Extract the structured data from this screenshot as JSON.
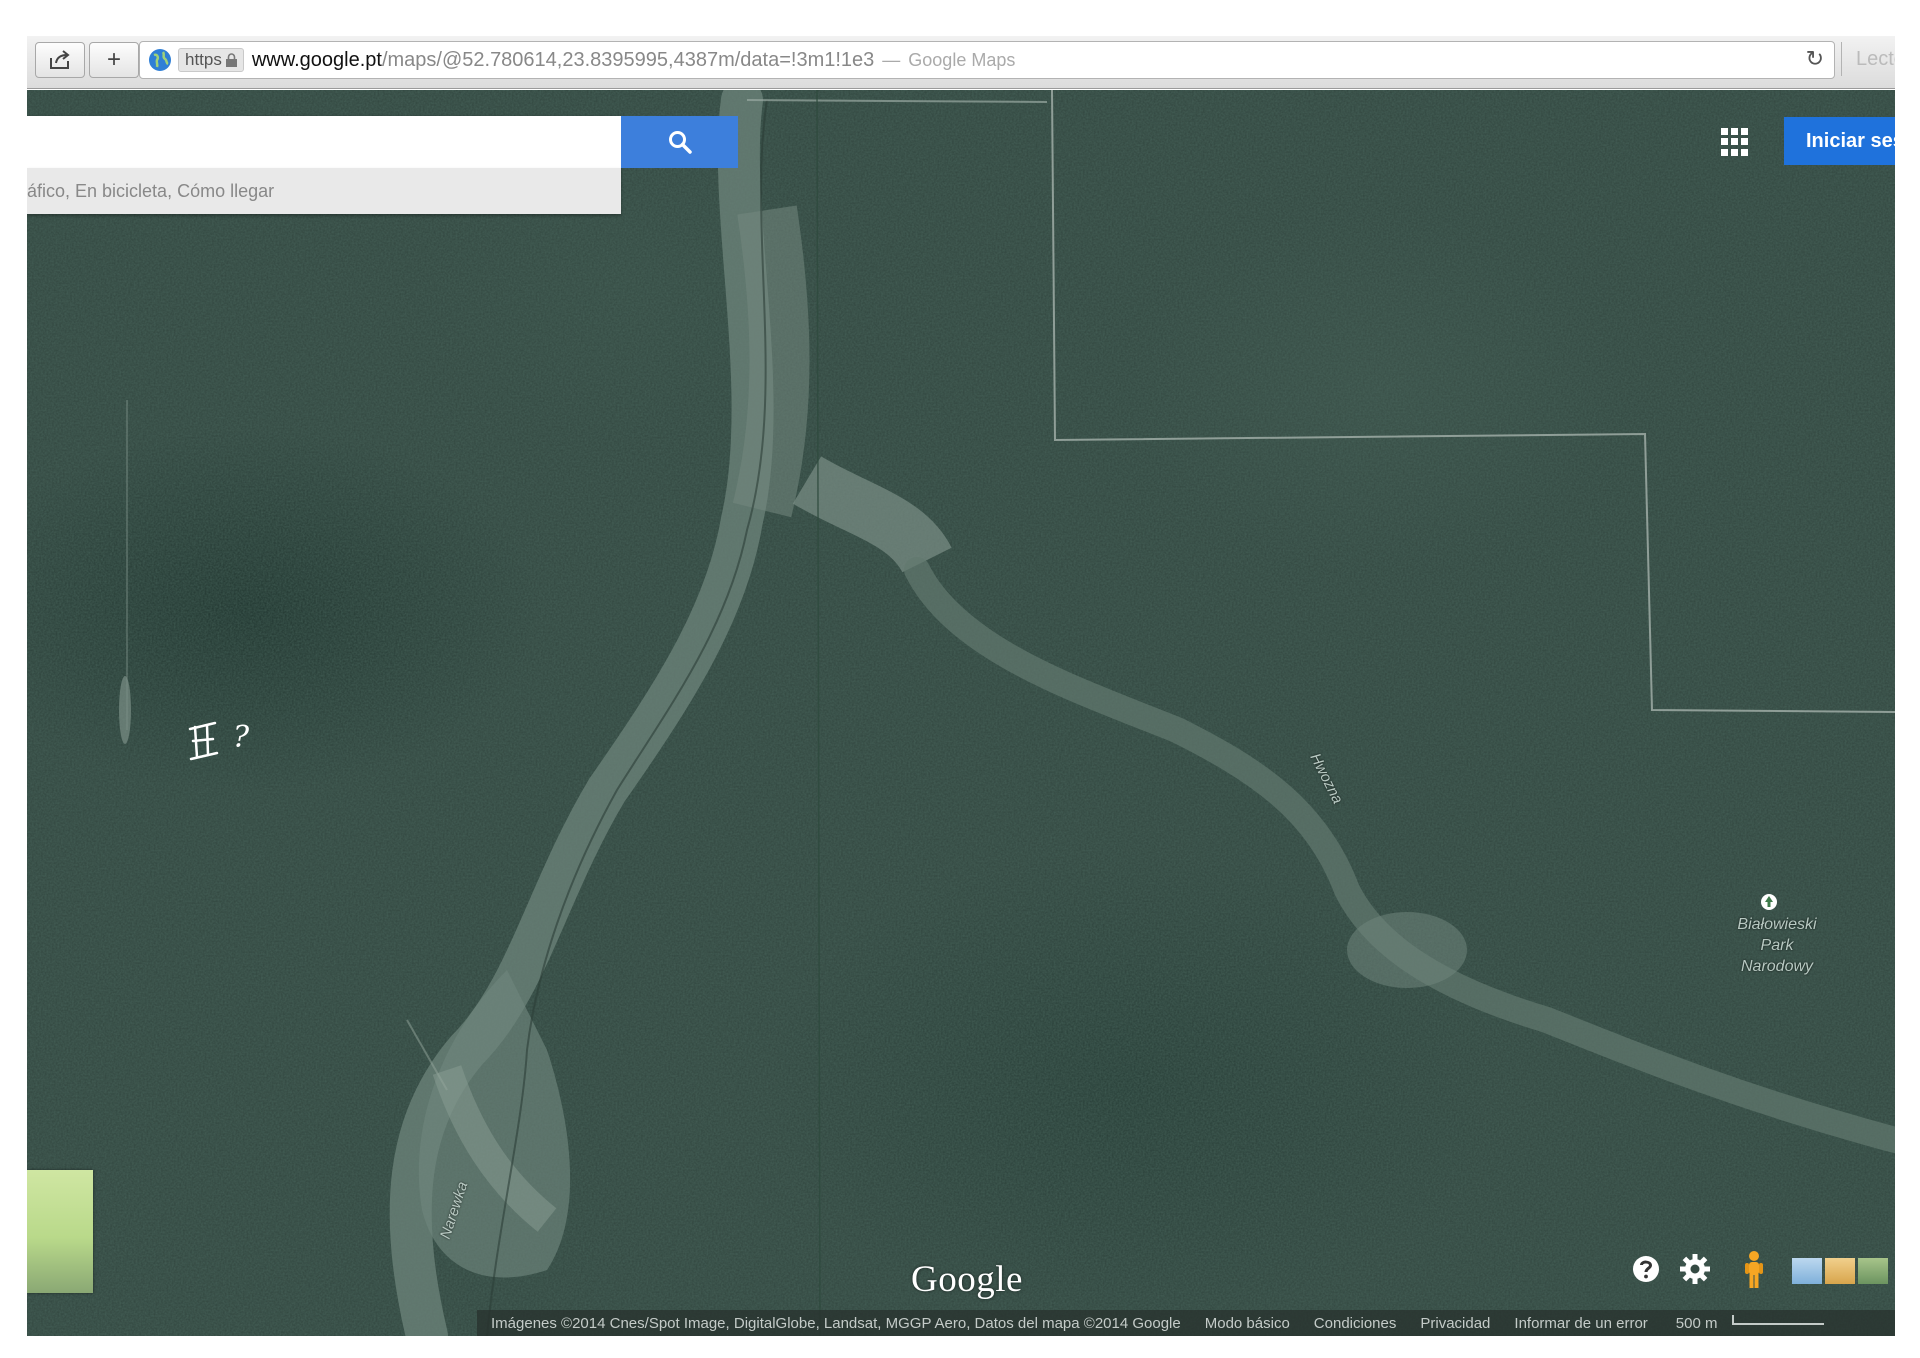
{
  "browser": {
    "url_host": "www.google.pt",
    "url_path": "/maps/@52.780614,23.8395995,4387m/data=!3m1!1e3",
    "url_separator": "—",
    "page_title": "Google Maps",
    "https_label": "https",
    "reader_label": "Lecto",
    "share_icon": "share-icon",
    "new_tab_icon": "plus-icon",
    "reload_icon": "reload-icon"
  },
  "search": {
    "input_value": "",
    "options_text": "áfico, En bicicleta, Cómo llegar",
    "button_icon": "search-icon"
  },
  "header": {
    "apps_icon": "apps-grid-icon",
    "signin_label": "Iniciar ses"
  },
  "map": {
    "rivers": [
      {
        "name": "Hwozna"
      },
      {
        "name": "Narewka"
      }
    ],
    "park": {
      "name": "Białowieski Park Narodowy"
    },
    "handwritten_note": "?",
    "logo_text": "Google"
  },
  "controls": {
    "help_icon": "help-icon",
    "settings_icon": "gear-icon",
    "pegman_icon": "pegman-icon",
    "layers": [
      "map-layer",
      "terrain-layer",
      "earth-layer"
    ]
  },
  "footer": {
    "attribution": "Imágenes ©2014 Cnes/Spot Image, DigitalGlobe, Landsat, MGGP Aero, Datos del mapa ©2014 Google",
    "links": [
      "Modo básico",
      "Condiciones",
      "Privacidad",
      "Informar de un error"
    ],
    "scale_label": "500 m"
  },
  "colors": {
    "accent_blue": "#3d7fdc",
    "signin_blue": "#1f72dc",
    "map_green": "#354a43"
  }
}
